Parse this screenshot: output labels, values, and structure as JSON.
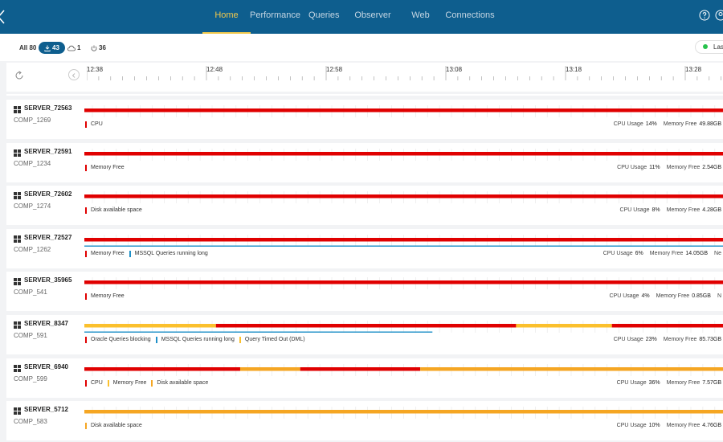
{
  "colors": {
    "header_bg": "#0e5e8e",
    "active_nav": "#f2c94c",
    "critical": "#e00000",
    "warning": "#fbc02d",
    "caution": "#f5a623",
    "info": "#1e90c8"
  },
  "nav": {
    "items": [
      {
        "label": "Home",
        "active": true
      },
      {
        "label": "Performance",
        "active": false
      },
      {
        "label": "Queries",
        "active": false
      },
      {
        "label": "Observer",
        "active": false
      },
      {
        "label": "Web",
        "active": false
      },
      {
        "label": "Connections",
        "active": false
      }
    ],
    "help_icon": "question-circle-icon",
    "user_icon": "user-circle-icon"
  },
  "filters": {
    "all_label": "All 80",
    "download_count": "43",
    "cloud_count": "1",
    "power_count": "36",
    "last_label": "Las"
  },
  "timeline": {
    "ticks": [
      "12:38",
      "12:48",
      "12:58",
      "13:08",
      "13:18",
      "13:28"
    ]
  },
  "servers": [
    {
      "name": "SERVER_72563",
      "comp": "COMP_1269",
      "segments": [
        {
          "start": 0,
          "end": 1,
          "color": "critical"
        }
      ],
      "info_line": null,
      "legend": [
        {
          "label": "CPU",
          "color": "critical"
        }
      ],
      "cpu_label": "CPU Usage",
      "cpu": "14%",
      "mem_label": "Memory Free",
      "mem": "49.88GB",
      "extra": ""
    },
    {
      "name": "SERVER_72591",
      "comp": "COMP_1234",
      "segments": [
        {
          "start": 0,
          "end": 1,
          "color": "critical"
        }
      ],
      "info_line": null,
      "legend": [
        {
          "label": "Memory Free",
          "color": "critical"
        }
      ],
      "cpu_label": "CPU Usage",
      "cpu": "11%",
      "mem_label": "Memory Free",
      "mem": "2.54GB",
      "extra": ""
    },
    {
      "name": "SERVER_72602",
      "comp": "COMP_1274",
      "segments": [
        {
          "start": 0,
          "end": 1,
          "color": "critical"
        }
      ],
      "info_line": null,
      "legend": [
        {
          "label": "Disk available space",
          "color": "critical"
        }
      ],
      "cpu_label": "CPU Usage",
      "cpu": "8%",
      "mem_label": "Memory Free",
      "mem": "4.28GB",
      "extra": ""
    },
    {
      "name": "SERVER_72527",
      "comp": "COMP_1262",
      "segments": [
        {
          "start": 0,
          "end": 1,
          "color": "critical"
        }
      ],
      "info_line": {
        "start": 0,
        "end": 1
      },
      "legend": [
        {
          "label": "Memory Free",
          "color": "critical"
        },
        {
          "label": "MSSQL Queries running long",
          "color": "info"
        }
      ],
      "cpu_label": "CPU Usage",
      "cpu": "6%",
      "mem_label": "Memory Free",
      "mem": "14.05GB",
      "extra": "Ne"
    },
    {
      "name": "SERVER_35965",
      "comp": "COMP_541",
      "segments": [
        {
          "start": 0,
          "end": 1,
          "color": "critical"
        }
      ],
      "info_line": null,
      "legend": [
        {
          "label": "Memory Free",
          "color": "critical"
        }
      ],
      "cpu_label": "CPU Usage",
      "cpu": "4%",
      "mem_label": "Memory Free",
      "mem": "0.85GB",
      "extra": "N"
    },
    {
      "name": "SERVER_8347",
      "comp": "COMP_591",
      "segments": [
        {
          "start": 0,
          "end": 0.206,
          "color": "warning"
        },
        {
          "start": 0.206,
          "end": 0.676,
          "color": "critical"
        },
        {
          "start": 0.676,
          "end": 0.826,
          "color": "warning"
        },
        {
          "start": 0.826,
          "end": 1,
          "color": "critical"
        }
      ],
      "info_line": {
        "start": 0,
        "end": 0.545
      },
      "legend": [
        {
          "label": "Oracle Queries blocking",
          "color": "critical"
        },
        {
          "label": "MSSQL Queries running long",
          "color": "info"
        },
        {
          "label": "Query Timed Out (DML)",
          "color": "warning"
        }
      ],
      "cpu_label": "CPU Usage",
      "cpu": "23%",
      "mem_label": "Memory Free",
      "mem": "85.73GB",
      "extra": ""
    },
    {
      "name": "SERVER_6940",
      "comp": "COMP_599",
      "segments": [
        {
          "start": 0,
          "end": 0.244,
          "color": "critical"
        },
        {
          "start": 0.244,
          "end": 0.338,
          "color": "caution"
        },
        {
          "start": 0.338,
          "end": 0.526,
          "color": "critical"
        },
        {
          "start": 0.526,
          "end": 1,
          "color": "caution"
        }
      ],
      "info_line": null,
      "legend": [
        {
          "label": "CPU",
          "color": "critical"
        },
        {
          "label": "Memory Free",
          "color": "warning"
        },
        {
          "label": "Disk available space",
          "color": "caution"
        }
      ],
      "cpu_label": "CPU Usage",
      "cpu": "36%",
      "mem_label": "Memory Free",
      "mem": "7.57GB",
      "extra": ""
    },
    {
      "name": "SERVER_5712",
      "comp": "COMP_583",
      "segments": [
        {
          "start": 0,
          "end": 1,
          "color": "caution"
        }
      ],
      "info_line": null,
      "legend": [
        {
          "label": "Disk available space",
          "color": "caution"
        }
      ],
      "cpu_label": "CPU Usage",
      "cpu": "10%",
      "mem_label": "Memory Free",
      "mem": "4.76GB",
      "extra": ""
    }
  ]
}
